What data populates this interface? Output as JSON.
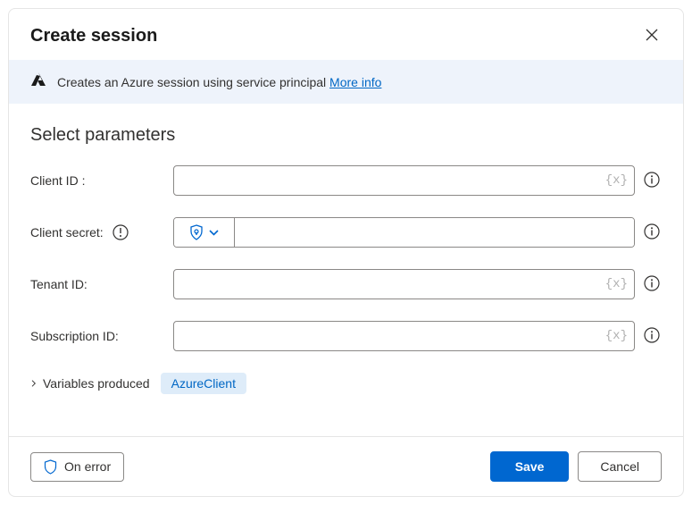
{
  "header": {
    "title": "Create session"
  },
  "banner": {
    "text": "Creates an Azure session using service principal",
    "link_label": "More info"
  },
  "section_title": "Select parameters",
  "fields": {
    "client_id": {
      "label": "Client ID :",
      "value": "",
      "var_hint": "{x}"
    },
    "client_secret": {
      "label": "Client secret:",
      "value": ""
    },
    "tenant_id": {
      "label": "Tenant ID:",
      "value": "",
      "var_hint": "{x}"
    },
    "subscription_id": {
      "label": "Subscription ID:",
      "value": "",
      "var_hint": "{x}"
    }
  },
  "variables_produced": {
    "label": "Variables produced",
    "chip": "AzureClient"
  },
  "footer": {
    "on_error": "On error",
    "save": "Save",
    "cancel": "Cancel"
  },
  "colors": {
    "primary": "#0067d0",
    "link": "#0067c5",
    "banner_bg": "#eef3fb"
  }
}
